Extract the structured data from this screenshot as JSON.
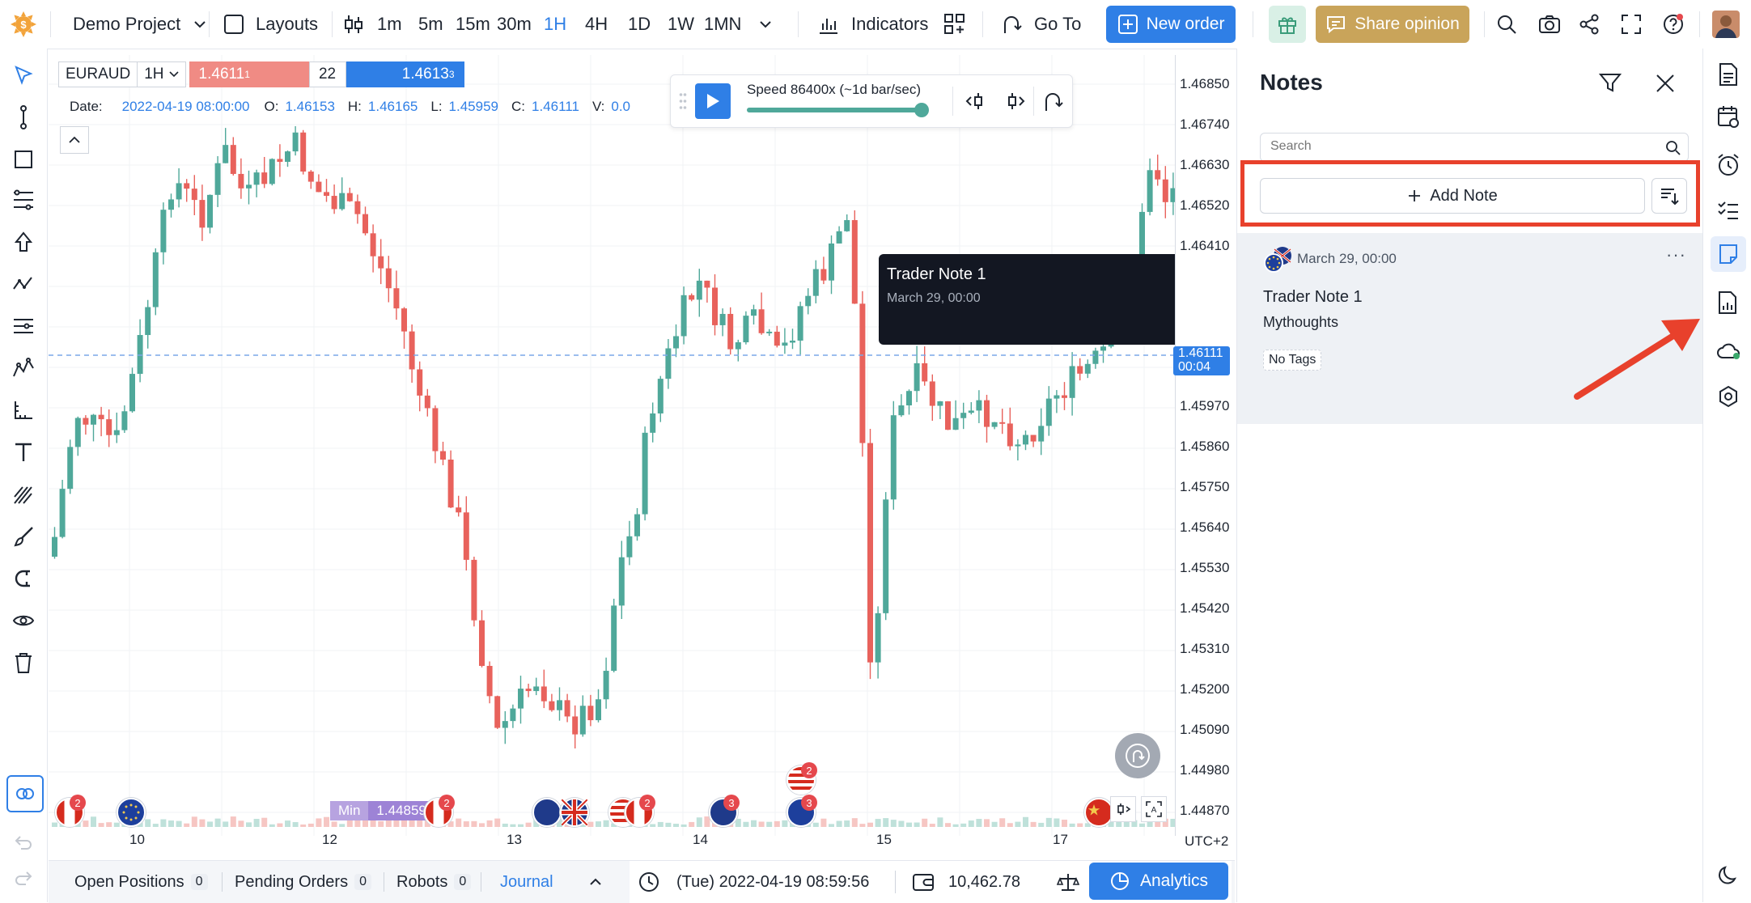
{
  "topbar": {
    "project": "Demo Project",
    "layouts": "Layouts",
    "timeframes": [
      "1m",
      "5m",
      "15m",
      "30m",
      "1H",
      "4H",
      "1D",
      "1W",
      "1MN"
    ],
    "active_timeframe": "1H",
    "indicators": "Indicators",
    "goto": "Go To",
    "new_order": "New order",
    "share_opinion": "Share opinion"
  },
  "symbol_bar": {
    "symbol": "EURAUD",
    "interval": "1H",
    "bid": "1.4611",
    "bid_sup": "1",
    "spread": "22",
    "ask": "1.4613",
    "ask_sup": "3"
  },
  "ohlc": {
    "date_label": "Date:",
    "date": "2022-04-19 08:00:00",
    "o_label": "O:",
    "o": "1.46153",
    "h_label": "H:",
    "h": "1.46165",
    "l_label": "L:",
    "l": "1.45959",
    "c_label": "C:",
    "c": "1.46111",
    "v_label": "V:",
    "v": "0.0"
  },
  "playback": {
    "speed": "Speed 86400x (~1d bar/sec)",
    "progress": 1.0
  },
  "tooltip": {
    "title": "Trader Note 1",
    "date": "March 29, 00:00"
  },
  "price_axis": {
    "labels": [
      "1.46850",
      "1.46740",
      "1.46630",
      "1.46520",
      "1.46410",
      "1.45970",
      "1.45860",
      "1.45750",
      "1.45640",
      "1.45530",
      "1.45420",
      "1.45310",
      "1.45200",
      "1.45090",
      "1.44980",
      "1.44870"
    ],
    "current_price": "1.46111",
    "current_time": "00:04",
    "timezone": "UTC+2"
  },
  "time_axis": {
    "labels": [
      "10",
      "12",
      "13",
      "14",
      "15",
      "17"
    ]
  },
  "min_marker": {
    "label": "Min",
    "value": "1.44859"
  },
  "event_counts": [
    "2",
    "2",
    "2",
    "3",
    "2",
    "3",
    "2"
  ],
  "notes": {
    "title": "Notes",
    "search_placeholder": "Search",
    "add_note": "Add Note",
    "items": [
      {
        "date": "March 29, 00:00",
        "title": "Trader Note 1",
        "body": "Mythoughts",
        "tags": "No Tags"
      }
    ]
  },
  "bottombar": {
    "open_positions": "Open Positions",
    "open_positions_count": "0",
    "pending_orders": "Pending Orders",
    "pending_orders_count": "0",
    "robots": "Robots",
    "robots_count": "0",
    "journal": "Journal",
    "datetime": "(Tue) 2022-04-19 08:59:56",
    "balance": "10,462.78",
    "analytics": "Analytics"
  },
  "colors": {
    "accent": "#2f7fe6",
    "bull": "#4fa89a",
    "bear": "#e8625c",
    "highlight": "#e8412c",
    "share": "#c9a45a",
    "tooltip_bg": "#131722"
  }
}
